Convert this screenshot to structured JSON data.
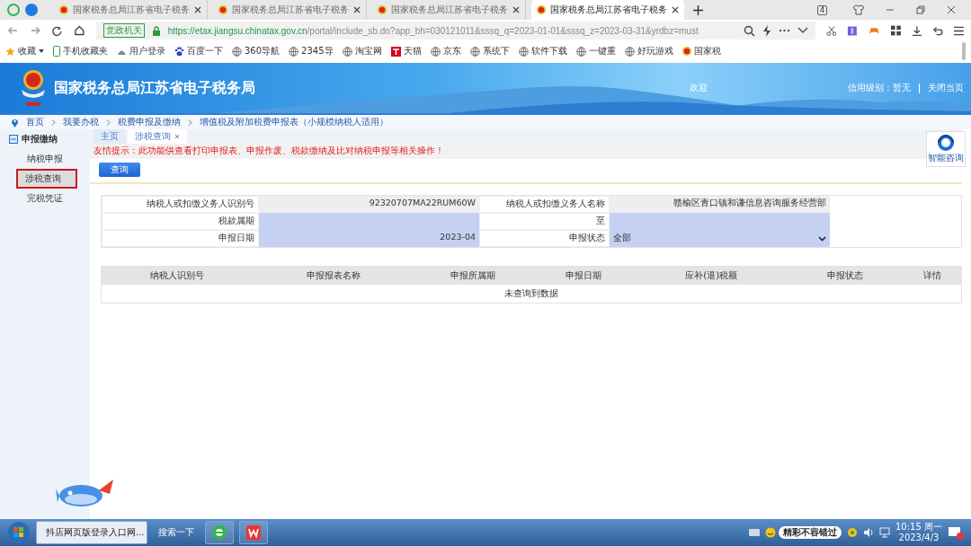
{
  "browser": {
    "tabs": [
      {
        "label": "国家税务总局江苏省电子税务",
        "selected": false
      },
      {
        "label": "国家税务总局江苏省电子税务",
        "selected": false
      },
      {
        "label": "国家税务总局江苏省电子税务",
        "selected": false
      },
      {
        "label": "国家税务总局江苏省电子税务",
        "selected": true
      }
    ],
    "tab_count": "4",
    "address": {
      "badge": "党政机关",
      "url_host": "https://etax.jiangsu.chinatax.gov.cn",
      "url_rest": "/portal/include_sb.do?app_bh=030121011&sssq_q=2023-01-01&sssq_z=2023-03-31&yrdbz=must"
    },
    "bookmarks": [
      {
        "label": "收藏",
        "kind": "star"
      },
      {
        "label": "手机收藏夹",
        "kind": "phone"
      },
      {
        "label": "用户登录",
        "kind": "user"
      },
      {
        "label": "百度一下",
        "kind": "paw"
      },
      {
        "label": "360导航",
        "kind": "globe"
      },
      {
        "label": "2345导",
        "kind": "globe"
      },
      {
        "label": "淘宝网",
        "kind": "globe"
      },
      {
        "label": "天猫",
        "kind": "tmall"
      },
      {
        "label": "京东",
        "kind": "globe"
      },
      {
        "label": "系统下",
        "kind": "globe"
      },
      {
        "label": "软件下载",
        "kind": "globe"
      },
      {
        "label": "一键重",
        "kind": "globe"
      },
      {
        "label": "好玩游戏",
        "kind": "globe"
      },
      {
        "label": "国家税",
        "kind": "emblem"
      }
    ]
  },
  "site": {
    "title": "国家税务总局江苏省电子税务局",
    "welcome": "欢迎",
    "credit": "信用级别：暂无",
    "close": "关闭当页"
  },
  "breadcrumb": [
    "首页",
    "我要办税",
    "税费申报及缴纳",
    "增值税及附加税费申报表（小规模纳税人适用）"
  ],
  "sidebar": {
    "heading": "申报缴纳",
    "items": [
      {
        "label": "纳税申报",
        "selected": false
      },
      {
        "label": "涉税查询",
        "selected": true
      },
      {
        "label": "完税凭证",
        "selected": false
      }
    ]
  },
  "page_tabs": [
    {
      "label": "主页",
      "selected": false,
      "closable": false
    },
    {
      "label": "涉税查询",
      "selected": true,
      "closable": true
    }
  ],
  "notice": "友情提示：此功能供查看打印申报表、申报作废、税款缴纳及比对纳税申报等相关操作！",
  "query_button": "查询",
  "form": [
    {
      "label": "纳税人或扣缴义务人识别号",
      "value": "92320707MA22RUM60W",
      "kind": "readonly"
    },
    {
      "label": "纳税人或扣缴义务人名称",
      "value": "赣榆区青口镇和谦信息咨询服务经营部",
      "kind": "readonly"
    },
    {
      "label": "税款属期",
      "kind": "input"
    },
    {
      "label": "至",
      "kind": "input"
    },
    {
      "label": "申报日期",
      "value": "2023-04",
      "kind": "input"
    },
    {
      "label": "申报状态",
      "value": "全部",
      "kind": "select"
    }
  ],
  "results": {
    "columns": [
      "纳税人识别号",
      "申报报表名称",
      "申报所属期",
      "申报日期",
      "应补(退)税额",
      "申报状态",
      "详情"
    ],
    "empty_text": "未查询到数据"
  },
  "assistant": "智能咨询",
  "taskbar": {
    "items": [
      {
        "label": "抖店网页版登录入口网...",
        "kind": "ie"
      },
      {
        "label": "搜索一下",
        "kind": "search"
      },
      {
        "kind": "browser"
      },
      {
        "kind": "office"
      }
    ],
    "tray_text": "精彩不容错过",
    "time": "10:15 周一",
    "date": "2023/4/3"
  }
}
